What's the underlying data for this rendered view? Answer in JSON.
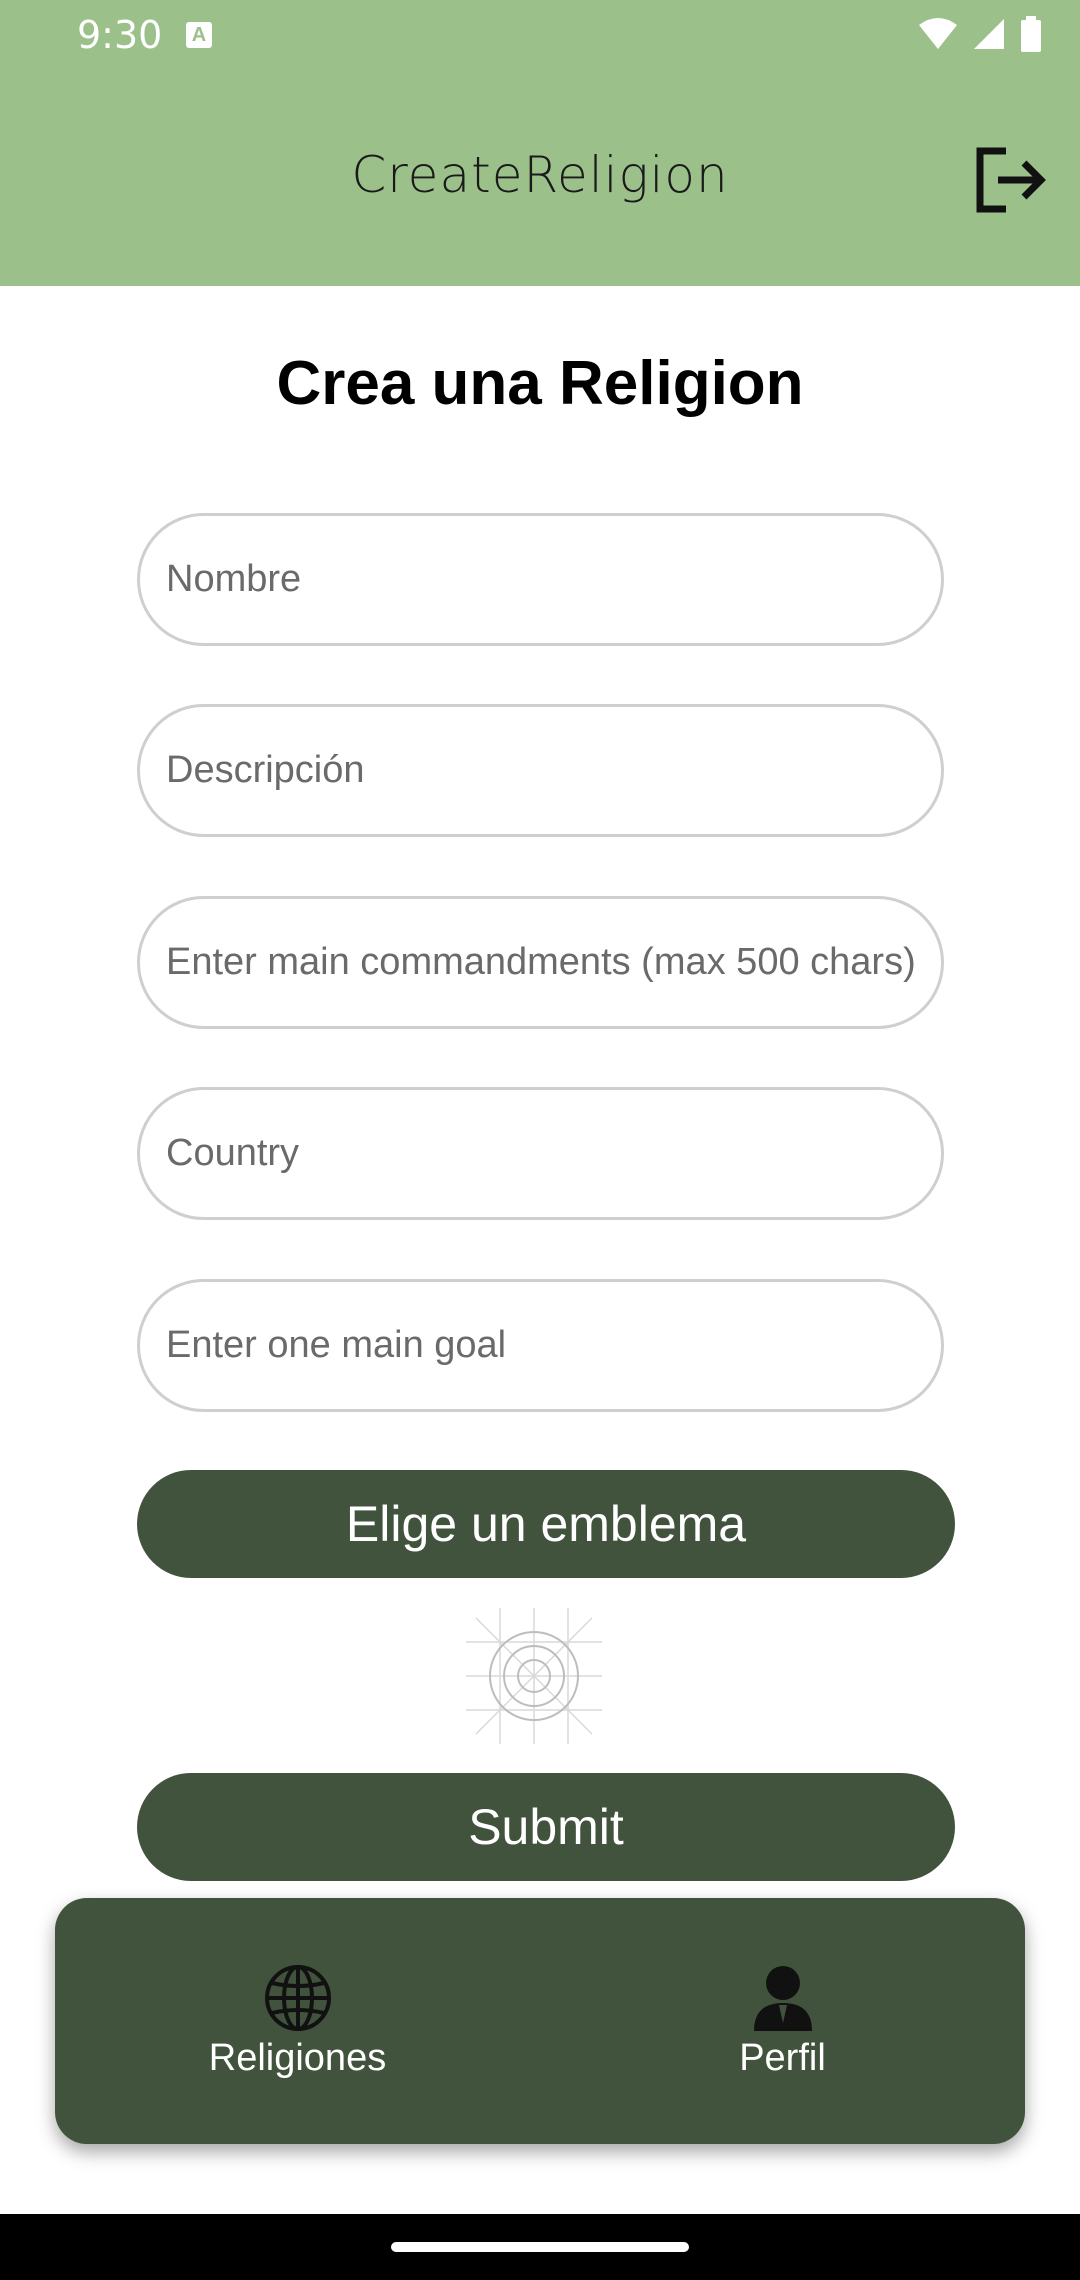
{
  "status_bar": {
    "time": "9:30",
    "icons": [
      "accessibility-a-icon",
      "wifi-icon",
      "signal-icon",
      "battery-icon"
    ]
  },
  "app_bar": {
    "title": "CreateReligion",
    "background_color": "#9cc08a",
    "logout_icon": "logout-icon"
  },
  "form": {
    "title": "Crea una Religion",
    "fields": [
      {
        "name": "nombre",
        "placeholder": "Nombre",
        "value": ""
      },
      {
        "name": "descripcion",
        "placeholder": "Descripción",
        "value": ""
      },
      {
        "name": "commandments",
        "placeholder": "Enter main commandments (max 500 chars)",
        "value": ""
      },
      {
        "name": "country",
        "placeholder": "Country",
        "value": ""
      },
      {
        "name": "goal",
        "placeholder": "Enter one main goal",
        "value": ""
      }
    ],
    "emblem_button_label": "Elige un emblema",
    "emblem_preview_icon": "emblem-placeholder-icon",
    "submit_label": "Submit",
    "button_color": "#41533c"
  },
  "bottom_nav": {
    "items": [
      {
        "label": "Religiones",
        "icon": "globe-icon"
      },
      {
        "label": "Perfil",
        "icon": "person-icon"
      }
    ]
  }
}
